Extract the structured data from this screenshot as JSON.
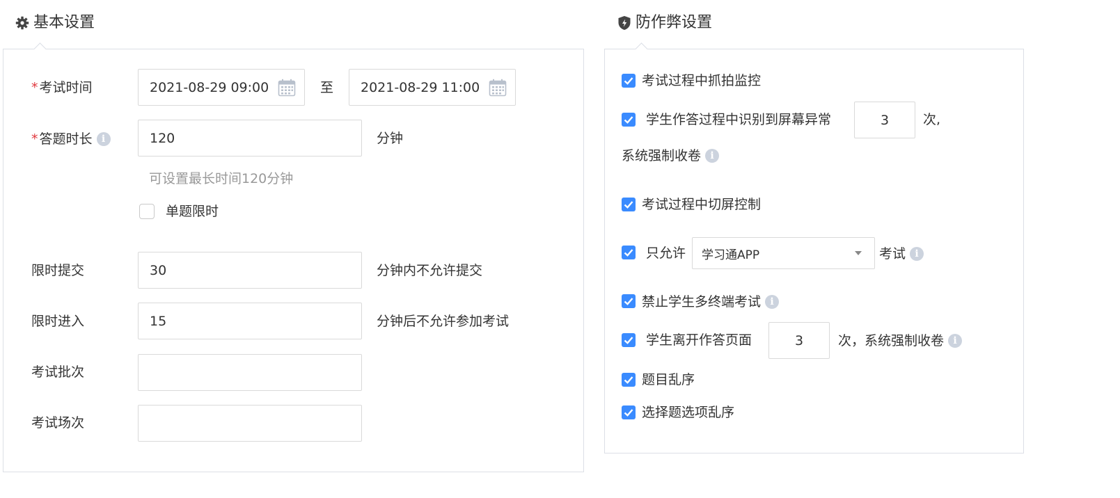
{
  "basic": {
    "title": "基本设置",
    "exam_time": {
      "required_mark": "*",
      "label": "考试时间",
      "start": "2021-08-29 09:00",
      "separator": "至",
      "end": "2021-08-29 11:00"
    },
    "duration": {
      "required_mark": "*",
      "label": "答题时长",
      "value": "120",
      "unit": "分钟",
      "hint": "可设置最长时间120分钟"
    },
    "single_limit": {
      "label": "单题限时",
      "checked": false
    },
    "submit_limit": {
      "label": "限时提交",
      "value": "30",
      "unit": "分钟内不允许提交"
    },
    "entry_limit": {
      "label": "限时进入",
      "value": "15",
      "unit": "分钟后不允许参加考试"
    },
    "batch": {
      "label": "考试批次",
      "value": ""
    },
    "session": {
      "label": "考试场次",
      "value": ""
    }
  },
  "anticheat": {
    "title": "防作弊设置",
    "capture_monitor": {
      "label": "考试过程中抓拍监控",
      "checked": true
    },
    "screen_anomaly": {
      "prefix": "学生作答过程中识别到屏幕异常",
      "count": "3",
      "suffix": "次,",
      "line2": "系统强制收卷",
      "checked": true
    },
    "switch_control": {
      "label": "考试过程中切屏控制",
      "checked": true
    },
    "only_allow": {
      "prefix": "只允许",
      "selected": "学习通APP",
      "suffix": "考试",
      "checked": true
    },
    "multi_terminal": {
      "label": "禁止学生多终端考试",
      "checked": true
    },
    "leave_page": {
      "prefix": "学生离开作答页面",
      "count": "3",
      "suffix": "次，系统强制收卷",
      "checked": true
    },
    "shuffle_questions": {
      "label": "题目乱序",
      "checked": true
    },
    "shuffle_options": {
      "label": "选择题选项乱序",
      "checked": true
    }
  },
  "colors": {
    "accent": "#3a8bff",
    "required": "#e0383e",
    "border": "#dcdfe6",
    "hint": "#999999",
    "info_icon": "#ccd3de"
  }
}
